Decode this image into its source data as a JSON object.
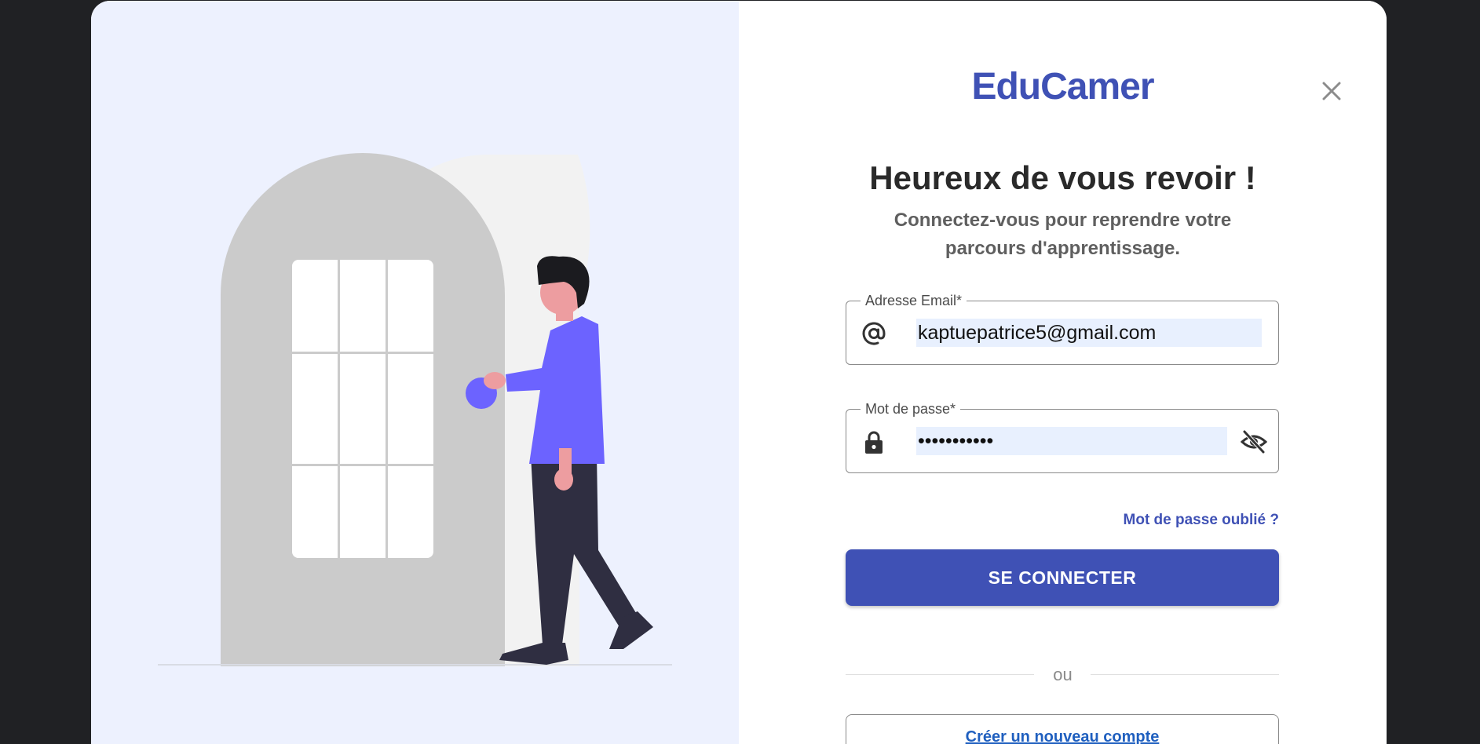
{
  "brand": {
    "name": "EduCamer",
    "color": "#3f51b5"
  },
  "header": {
    "close_icon": "close-icon"
  },
  "welcome": {
    "title": "Heureux de vous revoir !",
    "subtitle": "Connectez-vous pour reprendre votre parcours d'apprentissage."
  },
  "form": {
    "email": {
      "label": "Adresse Email*",
      "value": "kaptuepatrice5@gmail.com",
      "icon": "at-icon"
    },
    "password": {
      "label": "Mot de passe*",
      "value": "•••••••••••",
      "icon": "lock-icon",
      "toggle_icon": "eye-off-icon"
    },
    "forgot_label": "Mot de passe oublié ?",
    "submit_label": "SE CONNECTER"
  },
  "divider": {
    "label": "ou"
  },
  "signup": {
    "label": "Créer un nouveau compte"
  },
  "colors": {
    "accent": "#3f51b5",
    "illustration_bg": "#edf1fe",
    "figure_shirt": "#6c63ff"
  }
}
